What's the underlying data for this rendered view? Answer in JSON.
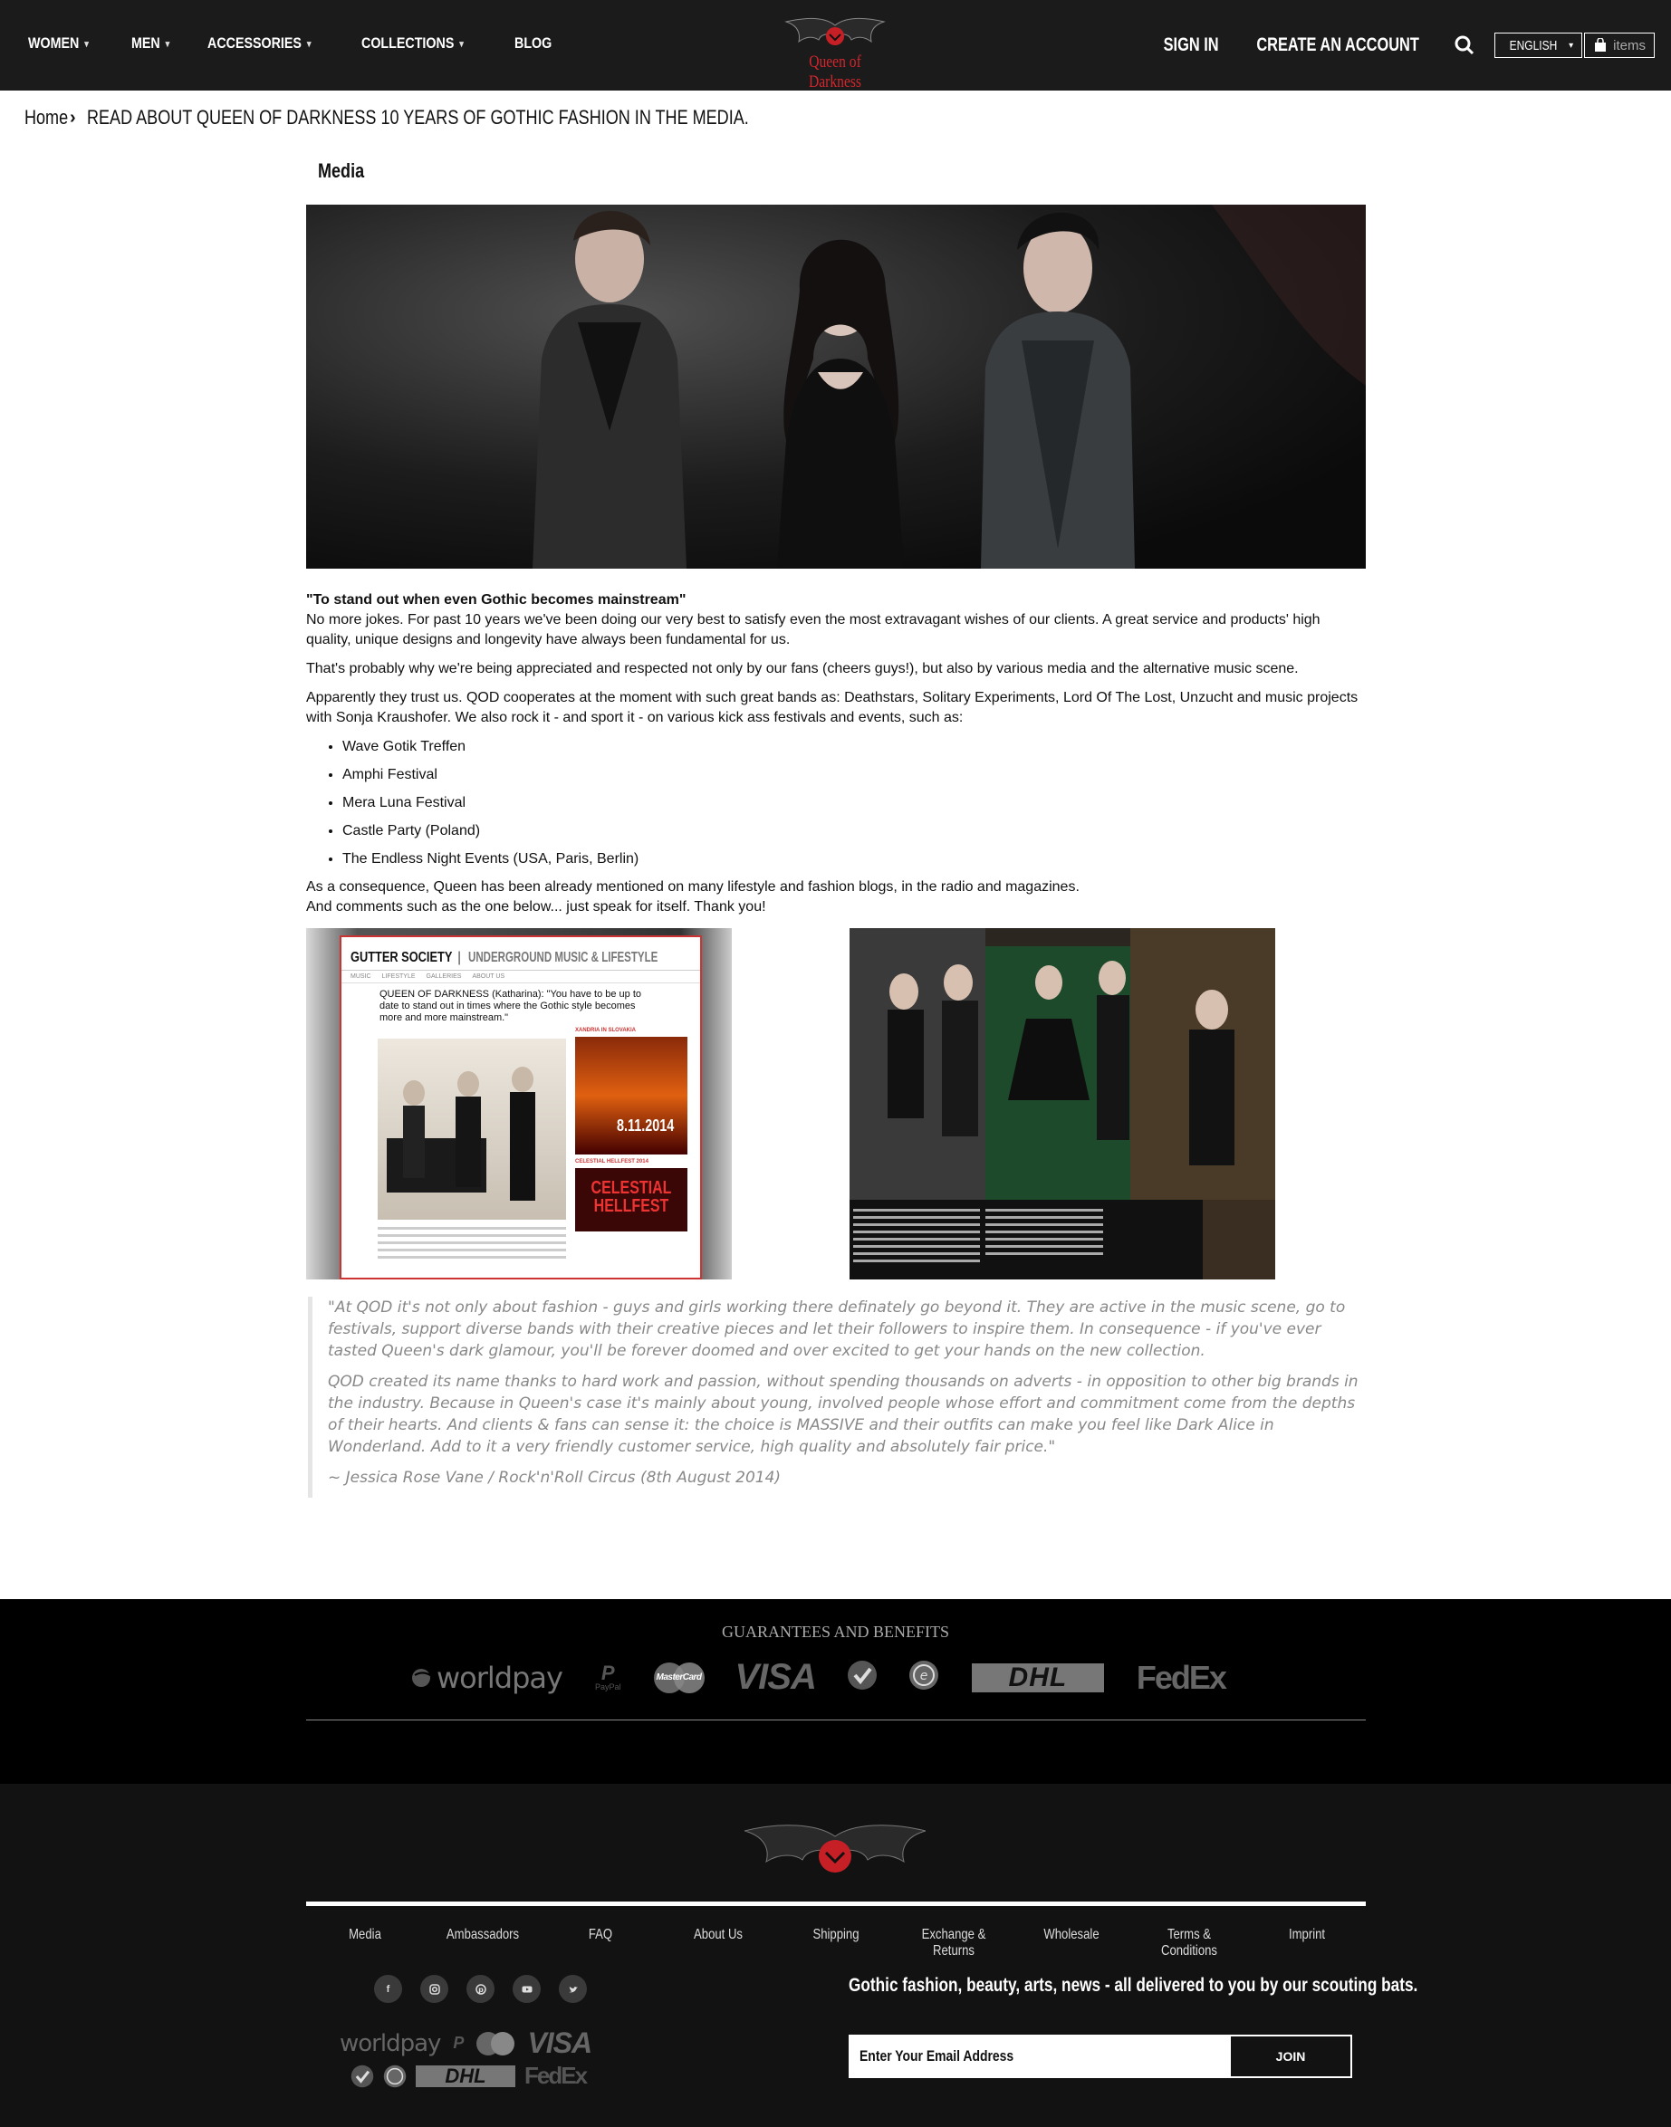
{
  "header": {
    "nav": [
      {
        "label": "WOMEN",
        "dropdown": true
      },
      {
        "label": "MEN",
        "dropdown": true
      },
      {
        "label": "ACCESSORIES",
        "dropdown": true
      },
      {
        "label": "COLLECTIONS",
        "dropdown": true
      },
      {
        "label": "BLOG",
        "dropdown": false
      }
    ],
    "logo_text": "Queen of Darkness",
    "sign_in": "SIGN IN",
    "create_account": "CREATE AN ACCOUNT",
    "language": "ENGLISH",
    "cart_label": "items",
    "icons": {
      "search": "search-icon",
      "cart": "shopping-bag-icon"
    }
  },
  "breadcrumb": {
    "home": "Home",
    "current": "READ ABOUT QUEEN OF DARKNESS 10 YEARS OF GOTHIC FASHION IN THE MEDIA."
  },
  "page_title": "Media",
  "article": {
    "lead": "\"To stand out when even Gothic becomes mainstream\"",
    "p1": "No more jokes. For past 10 years we've been doing our very best to satisfy even the most extravagant wishes of our clients. A great service and products' high quality, unique designs and longevity have always been fundamental for us.",
    "p2": "That's probably why we're being appreciated and respected not only by our fans (cheers guys!), but also by various media and the alternative music scene.",
    "p3": "Apparently they trust us. QOD cooperates at the moment with such great bands as: Deathstars, Solitary Experiments, Lord Of The Lost, Unzucht and music projects with Sonja Kraushofer. We also rock it - and sport it - on various kick ass festivals and events, such as:",
    "events": [
      "Wave Gotik Treffen",
      "Amphi Festival",
      "Mera Luna Festival",
      "Castle Party (Poland)",
      "The Endless Night Events (USA, Paris, Berlin)"
    ],
    "p4a": "As a consequence, Queen has been already mentioned on many lifestyle and fashion blogs, in the radio and magazines.",
    "p4b": "And comments such as the one below... just speak for itself. Thank you!"
  },
  "press_clip": {
    "site": "GUTTER SOCIETY",
    "tagline": "UNDERGROUND MUSIC & LIFESTYLE",
    "menu": [
      "MUSIC",
      "LIFESTYLE",
      "GALLERIES",
      "ABOUT US"
    ],
    "headline": "QUEEN OF DARKNESS (Katharina): \"You have to be up to date to stand out in times where the Gothic style becomes more and more mainstream.\"",
    "sidebar1": "XANDRIA IN SLOVAKIA",
    "date": "8.11.2014",
    "sidebar2": "CELESTIAL HELLFEST 2014",
    "banner": "CELESTIAL HELLFEST"
  },
  "quote": {
    "q1": "\"At QOD it's not only about fashion - guys and girls working there definately go beyond it. They are active in the music scene, go to festivals, support diverse bands with their creative pieces and let their followers to inspire them. In consequence - if you've ever tasted Queen's dark glamour, you'll be forever doomed and over excited to get your hands on the new collection.",
    "q2": "QOD created its name thanks to hard work and passion, without spending thousands on adverts - in opposition to other big brands in the industry. Because in Queen's case it's mainly about young, involved people whose effort and commitment come from the depths of their hearts. And clients & fans can sense it: the choice is MASSIVE and their outfits can make you feel like Dark Alice in Wonderland. Add to it a very friendly customer service, high quality and absolutely fair price.\"",
    "attribution": "~ Jessica Rose Vane / Rock'n'Roll Circus (8th August 2014)"
  },
  "guarantees": {
    "title": "GUARANTEES AND BENEFITS",
    "logos": [
      "worldpay",
      "PayPal",
      "MasterCard",
      "VISA",
      "trusted-shop",
      "ekomi",
      "DHL",
      "FedEx"
    ]
  },
  "footer": {
    "links": [
      "Media",
      "Ambassadors",
      "FAQ",
      "About Us",
      "Shipping",
      "Exchange & Returns",
      "Wholesale",
      "Terms & Conditions",
      "Imprint"
    ],
    "socials": [
      "facebook-icon",
      "instagram-icon",
      "pinterest-icon",
      "youtube-icon",
      "twitter-icon"
    ],
    "newsletter_text": "Gothic fashion, beauty, arts, news - all delivered to you by our scouting bats.",
    "email_placeholder": "Enter Your Email Address",
    "join_label": "JOIN"
  },
  "colors": {
    "header_bg": "#1b1b1b",
    "brand_red": "#d3262d",
    "footer_bg": "#121212",
    "quote_text": "#888888"
  }
}
